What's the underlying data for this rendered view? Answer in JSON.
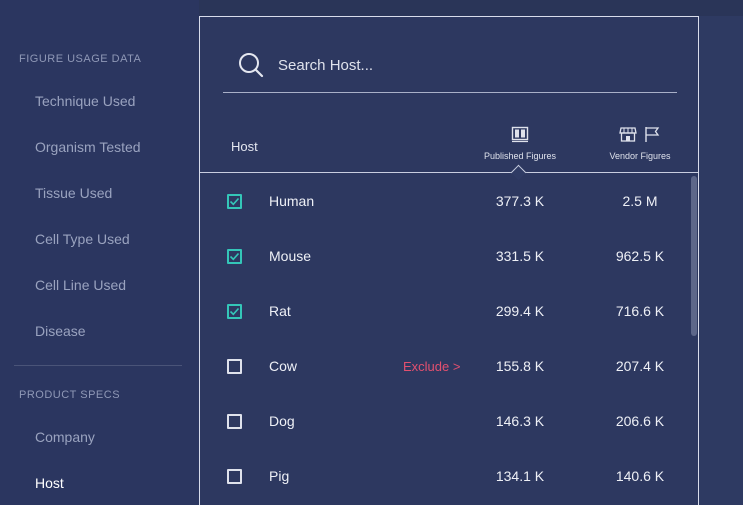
{
  "sidebar": {
    "sections": [
      {
        "title": "FIGURE USAGE DATA",
        "items": [
          "Technique Used",
          "Organism Tested",
          "Tissue Used",
          "Cell Type Used",
          "Cell Line Used",
          "Disease"
        ]
      },
      {
        "title": "PRODUCT SPECS",
        "items": [
          "Company",
          "Host"
        ]
      }
    ],
    "active_item": "Host"
  },
  "search": {
    "placeholder": "Search Host..."
  },
  "table": {
    "header_host": "Host",
    "header_published": "Published Figures",
    "header_vendor": "Vendor Figures",
    "exclude_label": "Exclude >",
    "rows": [
      {
        "name": "Human",
        "checked": true,
        "published": "377.3 K",
        "vendor": "2.5 M"
      },
      {
        "name": "Mouse",
        "checked": true,
        "published": "331.5 K",
        "vendor": "962.5 K"
      },
      {
        "name": "Rat",
        "checked": true,
        "published": "299.4 K",
        "vendor": "716.6 K"
      },
      {
        "name": "Cow",
        "checked": false,
        "published": "155.8 K",
        "vendor": "207.4 K",
        "show_exclude": true
      },
      {
        "name": "Dog",
        "checked": false,
        "published": "146.3 K",
        "vendor": "206.6 K"
      },
      {
        "name": "Pig",
        "checked": false,
        "published": "134.1 K",
        "vendor": "140.6 K"
      }
    ]
  },
  "colors": {
    "check_accent": "#34c6b8",
    "exclude": "#e2506f"
  }
}
